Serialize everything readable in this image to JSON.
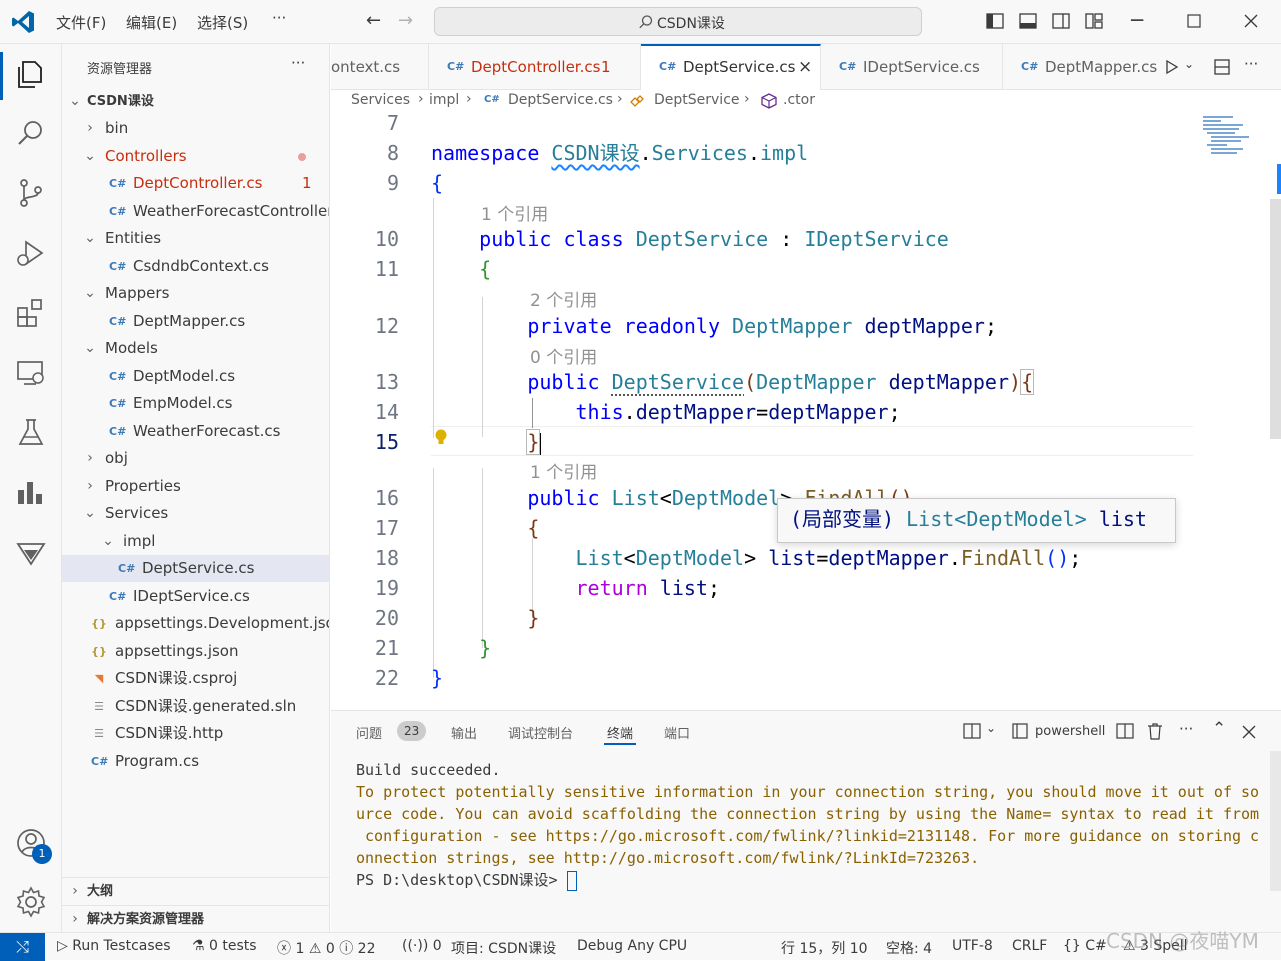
{
  "titlebar": {
    "menu": [
      "文件(F)",
      "编辑(E)",
      "选择(S)",
      "···"
    ],
    "search": "CSDN课设"
  },
  "sidebar": {
    "title": "资源管理器",
    "more": "···",
    "root": "CSDN课设",
    "items": [
      {
        "label": "bin",
        "type": "folder",
        "open": false,
        "depth": 1
      },
      {
        "label": "Controllers",
        "type": "folder",
        "open": true,
        "depth": 1,
        "error": true
      },
      {
        "label": "DeptController.cs",
        "type": "cs",
        "depth": 2,
        "error": true,
        "badge": "1"
      },
      {
        "label": "WeatherForecastController.cs",
        "type": "cs",
        "depth": 2
      },
      {
        "label": "Entities",
        "type": "folder",
        "open": true,
        "depth": 1
      },
      {
        "label": "CsdndbContext.cs",
        "type": "cs",
        "depth": 2
      },
      {
        "label": "Mappers",
        "type": "folder",
        "open": true,
        "depth": 1
      },
      {
        "label": "DeptMapper.cs",
        "type": "cs",
        "depth": 2
      },
      {
        "label": "Models",
        "type": "folder",
        "open": true,
        "depth": 1
      },
      {
        "label": "DeptModel.cs",
        "type": "cs",
        "depth": 2
      },
      {
        "label": "EmpModel.cs",
        "type": "cs",
        "depth": 2
      },
      {
        "label": "WeatherForecast.cs",
        "type": "cs",
        "depth": 2
      },
      {
        "label": "obj",
        "type": "folder",
        "open": false,
        "depth": 1
      },
      {
        "label": "Properties",
        "type": "folder",
        "open": false,
        "depth": 1
      },
      {
        "label": "Services",
        "type": "folder",
        "open": true,
        "depth": 1
      },
      {
        "label": "impl",
        "type": "folder",
        "open": true,
        "depth": 2
      },
      {
        "label": "DeptService.cs",
        "type": "cs",
        "depth": 3,
        "selected": true
      },
      {
        "label": "IDeptService.cs",
        "type": "cs",
        "depth": 2
      },
      {
        "label": "appsettings.Development.json",
        "type": "json",
        "depth": 1
      },
      {
        "label": "appsettings.json",
        "type": "json",
        "depth": 1
      },
      {
        "label": "CSDN课设.csproj",
        "type": "rss",
        "depth": 1
      },
      {
        "label": "CSDN课设.generated.sln",
        "type": "sln",
        "depth": 1
      },
      {
        "label": "CSDN课设.http",
        "type": "sln",
        "depth": 1
      },
      {
        "label": "Program.cs",
        "type": "cs",
        "depth": 1
      }
    ],
    "outline": "大纲",
    "solution_explorer": "解决方案资源管理器"
  },
  "tabs": [
    {
      "label": "ontext.cs",
      "icon": false
    },
    {
      "label": "DeptController.cs",
      "badge": "1",
      "error": true
    },
    {
      "label": "DeptService.cs",
      "active": true,
      "close": "×"
    },
    {
      "label": "IDeptService.cs"
    },
    {
      "label": "DeptMapper.cs"
    }
  ],
  "breadcrumb": [
    "Services",
    "impl",
    "DeptService.cs",
    "DeptService",
    ".ctor"
  ],
  "editor": {
    "line_numbers": [
      "7",
      "8",
      "9",
      "10",
      "11",
      "12",
      "13",
      "14",
      "15",
      "16",
      "17",
      "18",
      "19",
      "20",
      "21",
      "22"
    ],
    "current_line": "15",
    "codelens": [
      "1 个引用",
      "2 个引用",
      "0 个引用",
      "1 个引用"
    ],
    "hover": {
      "prefix": "(局部变量)",
      "type": "List<DeptModel>",
      "name": "list"
    }
  },
  "panel": {
    "tabs": [
      "问题",
      "输出",
      "调试控制台",
      "终端",
      "端口"
    ],
    "problems_count": "23",
    "active_tab": "终端",
    "terminal_name": "powershell",
    "output": [
      "Build succeeded.",
      "To protect potentially sensitive information in your connection string, you should move it out of so",
      "urce code. You can avoid scaffolding the connection string by using the Name= syntax to read it from",
      " configuration - see https://go.microsoft.com/fwlink/?linkid=2131148. For more guidance on storing c",
      "onnection strings, see http://go.microsoft.com/fwlink/?LinkId=723263."
    ],
    "prompt": "PS D:\\desktop\\CSDN课设> "
  },
  "status": {
    "remote": "⤭",
    "run": "Run Testcases",
    "tests": "0 tests",
    "errors": "1",
    "warnings": "0",
    "infos": "22",
    "ports": "0",
    "project": "项目: CSDN课设",
    "config": "Debug Any CPU",
    "position": "行 15，列 10",
    "spaces": "空格: 4",
    "encoding": "UTF-8",
    "eol": "CRLF",
    "language": "C#",
    "spell": "3 Spell"
  },
  "activity_badge": "1",
  "watermark": "CSDN @夜喵YM",
  "colors": {
    "accent": "#005fb8",
    "error": "#c72e0f",
    "selected": "#e4e6f1",
    "json": "#b39b38",
    "csharp": "#3c7ab8"
  }
}
